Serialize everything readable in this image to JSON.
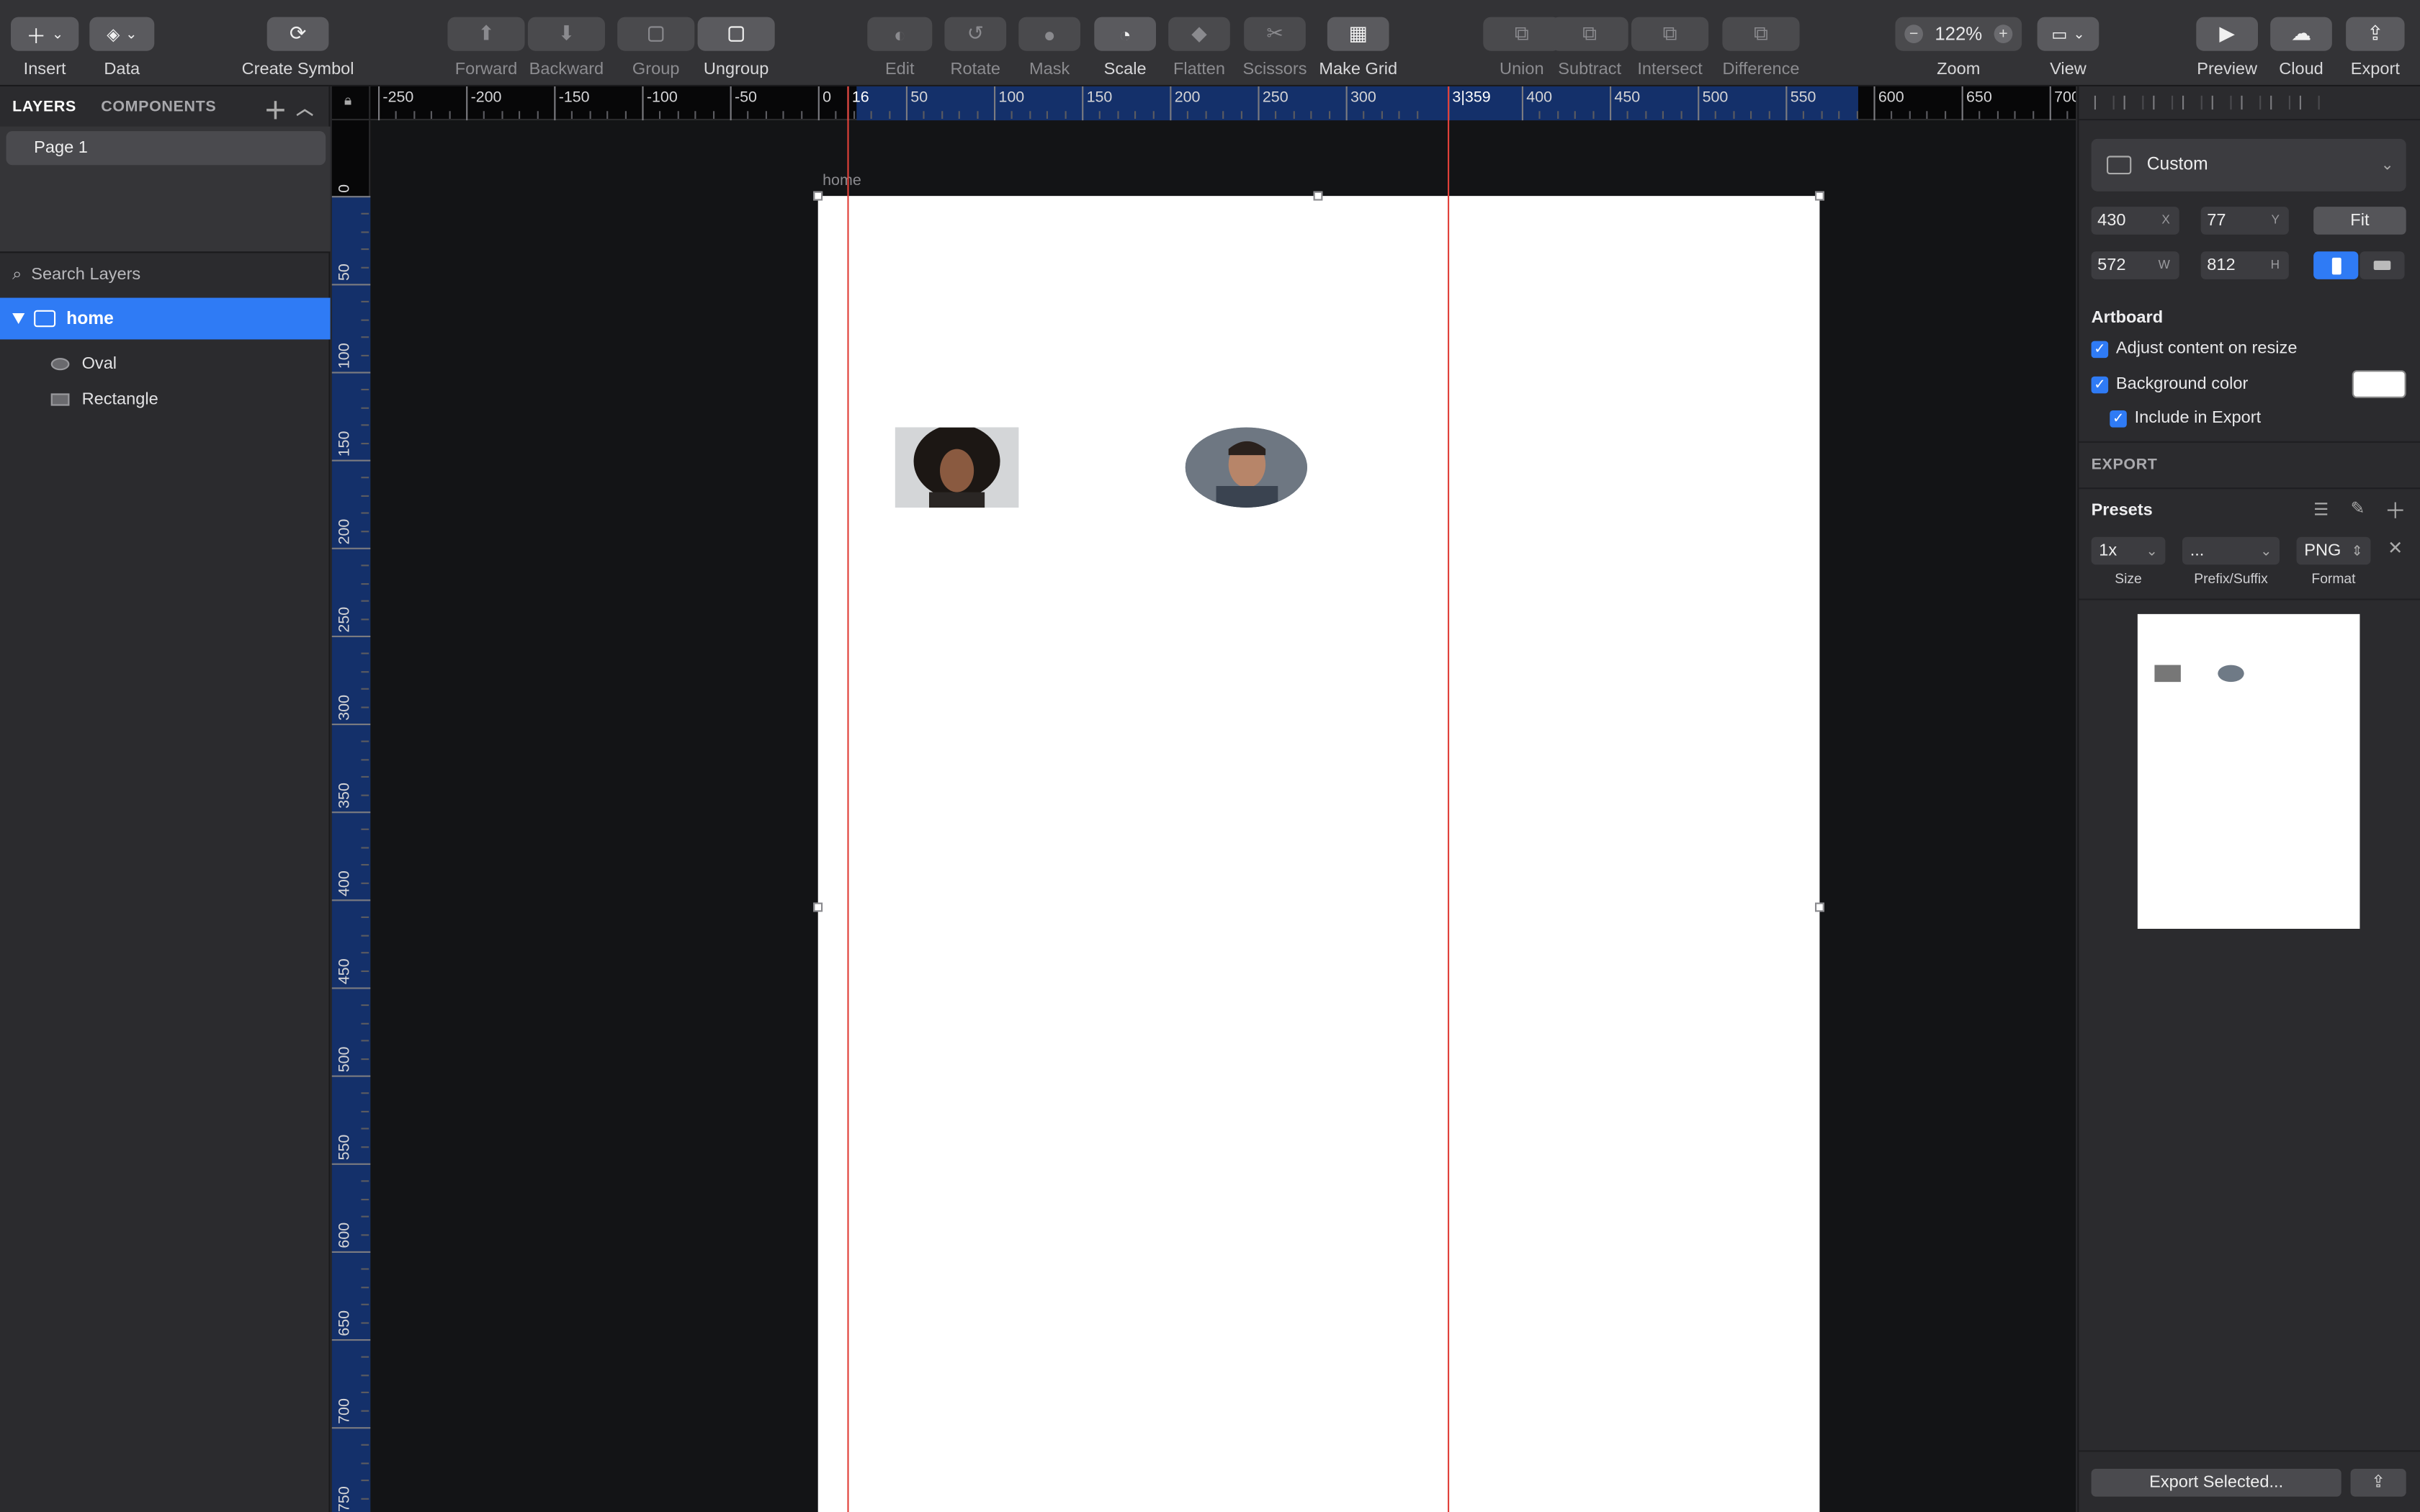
{
  "toolbar": {
    "insert": "Insert",
    "data": "Data",
    "create_symbol": "Create Symbol",
    "forward": "Forward",
    "backward": "Backward",
    "group": "Group",
    "ungroup": "Ungroup",
    "edit": "Edit",
    "rotate": "Rotate",
    "mask": "Mask",
    "scale": "Scale",
    "flatten": "Flatten",
    "scissors": "Scissors",
    "make_grid": "Make Grid",
    "union": "Union",
    "subtract": "Subtract",
    "intersect": "Intersect",
    "difference": "Difference",
    "zoom_value": "122%",
    "zoom": "Zoom",
    "view": "View",
    "preview": "Preview",
    "cloud": "Cloud",
    "export": "Export"
  },
  "left_panel": {
    "tab_layers": "LAYERS",
    "tab_components": "COMPONENTS",
    "page": "Page 1",
    "search_placeholder": "Search Layers",
    "artboard_layer": "home",
    "layers": [
      "Oval",
      "Rectangle"
    ]
  },
  "canvas": {
    "artboard_name": "home",
    "hruler_labels": [
      "-250",
      "-200",
      "-150",
      "-100",
      "-50",
      "0",
      "50",
      "100",
      "150",
      "200",
      "250",
      "300",
      "400",
      "450",
      "500",
      "550",
      "600",
      "650",
      "700"
    ],
    "hruler_markers": [
      "16",
      "3|359"
    ],
    "vruler_labels": [
      "0",
      "50",
      "100",
      "150",
      "200",
      "250",
      "300",
      "350",
      "400",
      "450",
      "500",
      "550",
      "600",
      "650",
      "700",
      "750"
    ]
  },
  "inspector": {
    "preset": "Custom",
    "x": "430",
    "y": "77",
    "w": "572",
    "h": "812",
    "x_unit": "X",
    "y_unit": "Y",
    "w_unit": "W",
    "h_unit": "H",
    "fit": "Fit",
    "artboard_title": "Artboard",
    "adjust_content": "Adjust content on resize",
    "background_color": "Background color",
    "include_in_export": "Include in Export",
    "export_title": "EXPORT",
    "presets_title": "Presets",
    "size_value": "1x",
    "prefix_value": "...",
    "format_value": "PNG",
    "size_label": "Size",
    "prefix_label": "Prefix/Suffix",
    "format_label": "Format",
    "export_selected": "Export Selected...",
    "background_swatch": "#ffffff"
  }
}
